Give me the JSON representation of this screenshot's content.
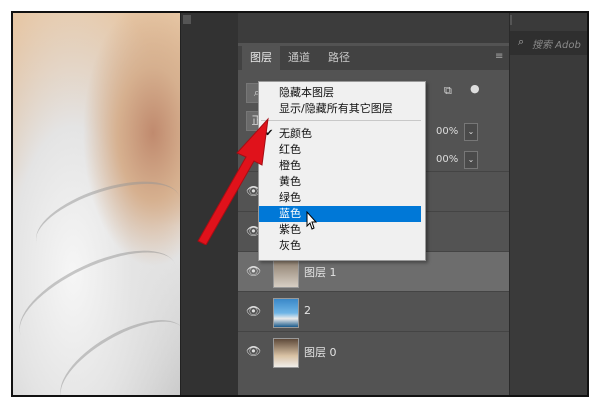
{
  "layers_panel": {
    "tabs": [
      "图层",
      "通道",
      "路径"
    ],
    "opacity_pct": "00%",
    "fill_pct": "00%",
    "layers": [
      {
        "name": "",
        "visible": true
      },
      {
        "name": "",
        "visible": true
      },
      {
        "name": "图层 1",
        "visible": true,
        "selected": true
      },
      {
        "name": "2",
        "visible": true
      },
      {
        "name": "图层 0",
        "visible": true
      }
    ]
  },
  "context_menu": {
    "items_top": [
      "隐藏本图层",
      "显示/隐藏所有其它图层"
    ],
    "colors": [
      "无颜色",
      "红色",
      "橙色",
      "黄色",
      "绿色",
      "蓝色",
      "紫色",
      "灰色"
    ],
    "checked": "无颜色",
    "highlighted": "蓝色"
  },
  "search": {
    "placeholder": "搜索 Adob"
  },
  "colors": {
    "highlight": "#0078d7",
    "arrow": "#e0121b"
  }
}
